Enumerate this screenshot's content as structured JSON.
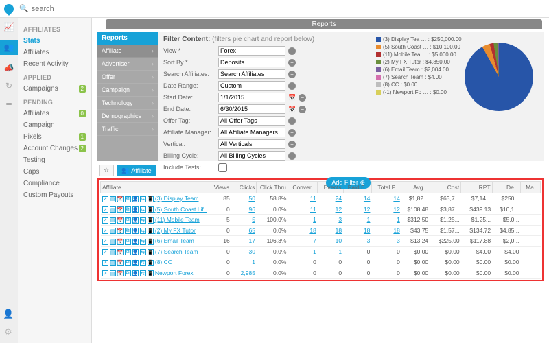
{
  "header": {
    "search_placeholder": "search"
  },
  "sidebar": {
    "groups": [
      {
        "title": "AFFILIATES",
        "items": [
          {
            "label": "Stats",
            "active": true
          },
          {
            "label": "Affiliates"
          },
          {
            "label": "Recent Activity"
          }
        ]
      },
      {
        "title": "APPLIED",
        "items": [
          {
            "label": "Campaigns",
            "badge": "2"
          }
        ]
      },
      {
        "title": "PENDING",
        "items": [
          {
            "label": "Affiliates",
            "badge": "0"
          },
          {
            "label": "Campaign"
          },
          {
            "label": "Pixels",
            "badge": "1"
          },
          {
            "label": "Account Changes",
            "badge": "2"
          }
        ]
      },
      {
        "title": "",
        "items": [
          {
            "label": "Testing"
          },
          {
            "label": "Caps"
          },
          {
            "label": "Compliance"
          },
          {
            "label": "Custom Payouts"
          }
        ]
      }
    ]
  },
  "panel_title": "Reports",
  "reports_nav": {
    "header": "Reports",
    "items": [
      "Affiliate",
      "Advertiser",
      "Offer",
      "Campaign",
      "Technology",
      "Demographics",
      "Traffic"
    ],
    "selected": 0
  },
  "filter_title": "Filter Content:",
  "filter_sub": "(filters pie chart and report below)",
  "filters": [
    {
      "label": "View *",
      "value": "Forex",
      "type": "select"
    },
    {
      "label": "Sort By *",
      "value": "Deposits",
      "type": "select"
    },
    {
      "label": "Search Affiliates:",
      "value": "Search Affiliates",
      "type": "text"
    },
    {
      "label": "Date Range:",
      "value": "Custom",
      "type": "select"
    },
    {
      "label": "Start Date:",
      "value": "1/1/2015",
      "type": "date"
    },
    {
      "label": "End Date:",
      "value": "6/30/2015",
      "type": "date"
    },
    {
      "label": "Offer Tag:",
      "value": "All Offer Tags",
      "type": "select"
    },
    {
      "label": "Affiliate Manager:",
      "value": "All Affiliate Managers",
      "type": "select"
    },
    {
      "label": "Vertical:",
      "value": "All Verticals",
      "type": "select"
    },
    {
      "label": "Billing Cycle:",
      "value": "All Billing Cycles",
      "type": "select"
    },
    {
      "label": "Include Tests:",
      "value": "",
      "type": "checkbox"
    }
  ],
  "add_filter_label": "Add Filter",
  "chart_data": {
    "type": "pie",
    "title": "",
    "series": [
      {
        "name": "(3) Display Tea …",
        "value": 250000.0,
        "color": "#2755a8",
        "label": "$250,000.00"
      },
      {
        "name": "(5) South Coast …",
        "value": 10100.0,
        "color": "#e88c2f",
        "label": "$10,100.00"
      },
      {
        "name": "(11) Mobile Tea …",
        "value": 5000.0,
        "color": "#b23030",
        "label": "$5,000.00"
      },
      {
        "name": "(2) My FX Tutor",
        "value": 4850.0,
        "color": "#6a8f3d",
        "label": "$4,850.00"
      },
      {
        "name": "(6) Email Team",
        "value": 2004.0,
        "color": "#7a5fa0",
        "label": "$2,004.00"
      },
      {
        "name": "(7) Search Team",
        "value": 4.0,
        "color": "#d46fae",
        "label": "$4.00"
      },
      {
        "name": "(8) CC",
        "value": 0.0,
        "color": "#bdbdbd",
        "label": "$0.00"
      },
      {
        "name": "(-1) Newport Fo …",
        "value": 0.0,
        "color": "#d8cf5a",
        "label": "$0.00"
      }
    ]
  },
  "tabs": {
    "star": "☆",
    "affiliate": "Affiliate"
  },
  "grid": {
    "columns": [
      "Affiliate",
      "Views",
      "Clicks",
      "Click Thru",
      "Conver...",
      "Events",
      "Paid E...",
      "Total P...",
      "Avg...",
      "Cost",
      "RPT",
      "De...",
      "Ma..."
    ],
    "rows": [
      {
        "aff": "(3) Display Team",
        "views": "85",
        "clicks": "50",
        "ct": "58.8%",
        "conv": "11",
        "ev": "24",
        "pe": "14",
        "tp": "14",
        "avg": "$1,82...",
        "cost": "$63,7...",
        "rpt": "$7,14...",
        "de": "$250...",
        "ma": ""
      },
      {
        "aff": "(5) South Coast Lif...",
        "views": "0",
        "clicks": "96",
        "ct": "0.0%",
        "conv": "11",
        "ev": "12",
        "pe": "12",
        "tp": "12",
        "avg": "$108.48",
        "cost": "$3,87...",
        "rpt": "$439.13",
        "de": "$10,1...",
        "ma": ""
      },
      {
        "aff": "(11) Mobile Team",
        "views": "5",
        "clicks": "5",
        "ct": "100.0%",
        "conv": "1",
        "ev": "3",
        "pe": "1",
        "tp": "1",
        "avg": "$312.50",
        "cost": "$1,25...",
        "rpt": "$1,25...",
        "de": "$5,0...",
        "ma": ""
      },
      {
        "aff": "(2) My FX Tutor",
        "views": "0",
        "clicks": "65",
        "ct": "0.0%",
        "conv": "18",
        "ev": "18",
        "pe": "18",
        "tp": "18",
        "avg": "$43.75",
        "cost": "$1,57...",
        "rpt": "$134.72",
        "de": "$4,85...",
        "ma": ""
      },
      {
        "aff": "(6) Email Team",
        "views": "16",
        "clicks": "17",
        "ct": "106.3%",
        "conv": "7",
        "ev": "10",
        "pe": "3",
        "tp": "3",
        "avg": "$13.24",
        "cost": "$225.00",
        "rpt": "$117.88",
        "de": "$2,0...",
        "ma": ""
      },
      {
        "aff": "(7) Search Team",
        "views": "0",
        "clicks": "30",
        "ct": "0.0%",
        "conv": "1",
        "ev": "1",
        "pe": "0",
        "tp": "0",
        "avg": "$0.00",
        "cost": "$0.00",
        "rpt": "$4.00",
        "de": "$4.00",
        "ma": ""
      },
      {
        "aff": "(8) CC",
        "views": "0",
        "clicks": "1",
        "ct": "0.0%",
        "conv": "0",
        "ev": "0",
        "pe": "0",
        "tp": "0",
        "avg": "$0.00",
        "cost": "$0.00",
        "rpt": "$0.00",
        "de": "$0.00",
        "ma": ""
      },
      {
        "aff": "Newport Forex",
        "views": "0",
        "clicks": "2,985",
        "ct": "0.0%",
        "conv": "0",
        "ev": "0",
        "pe": "0",
        "tp": "0",
        "avg": "$0.00",
        "cost": "$0.00",
        "rpt": "$0.00",
        "de": "$0.00",
        "ma": ""
      }
    ]
  }
}
